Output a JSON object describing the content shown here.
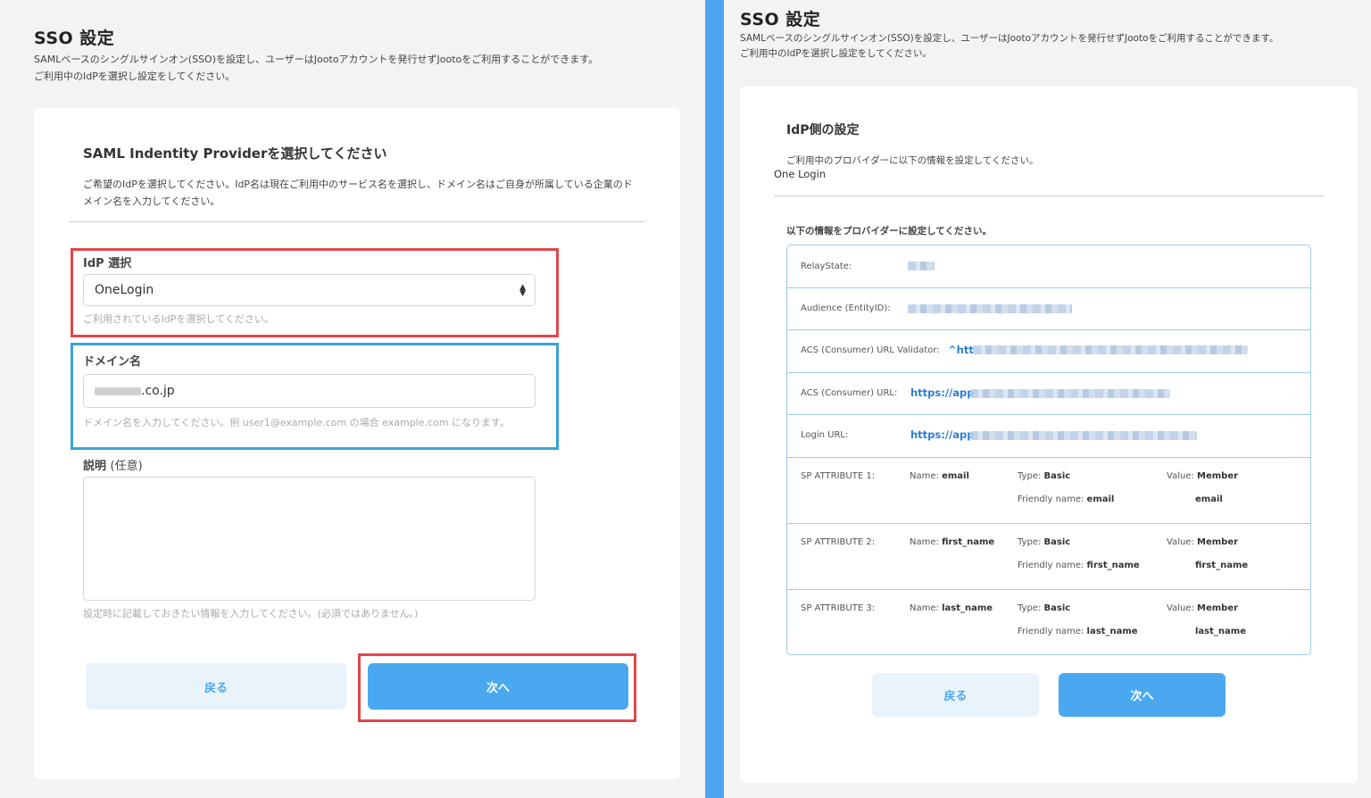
{
  "left": {
    "title": "SSO 設定",
    "desc_line1": "SAMLベースのシングルサインオン(SSO)を設定し、ユーザーはJootoアカウントを発行せずJootoをご利用することができます。",
    "desc_line2": "ご利用中のIdPを選択し設定をしてください。",
    "section_title": "SAML Indentity Providerを選択してください",
    "section_desc": "ご希望のIdPを選択してください。IdP名は現在ご利用中のサービス名を選択し、ドメイン名はご自身が所属している企業のドメイン名を入力してください。",
    "idp": {
      "label": "IdP 選択",
      "value": "OneLogin",
      "help": "ご利用されているIdPを選択してください。"
    },
    "domain": {
      "label": "ドメイン名",
      "value_suffix": ".co.jp",
      "help": "ドメイン名を入力してください。例 user1@example.com の場合 example.com になります。"
    },
    "description": {
      "label": "説明",
      "label_optional": "(任意)",
      "value": "",
      "help": "設定時に記載しておきたい情報を入力してください。(必須ではありません。)"
    },
    "back_label": "戻る",
    "next_label": "次へ"
  },
  "right": {
    "title": "SSO 設定",
    "desc_line1": "SAMLベースのシングルサインオン(SSO)を設定し、ユーザーはJootoアカウントを発行せずJootoをご利用することができます。",
    "desc_line2": "ご利用中のIdPを選択し設定をしてください。",
    "section_title": "IdP側の設定",
    "section_desc": "ご利用中のプロバイダーに以下の情報を設定してください。",
    "provider": "One Login",
    "instruction": "以下の情報をプロバイダーに設定してください。",
    "rows": [
      {
        "label": "RelayState:",
        "value": ""
      },
      {
        "label": "Audience (EntityID):",
        "value": ""
      },
      {
        "label": "ACS (Consumer) URL Validator:",
        "value": "^htt"
      },
      {
        "label": "ACS (Consumer) URL:",
        "value": "https://app"
      },
      {
        "label": "Login URL:",
        "value": "https://app"
      }
    ],
    "attributes": [
      {
        "label": "SP ATTRIBUTE 1:",
        "name_key": "Name:",
        "name": "email",
        "type_key": "Type:",
        "type": "Basic",
        "value_key": "Value:",
        "value": "Member",
        "friendly_key": "Friendly name:",
        "friendly": "email",
        "value2": "email"
      },
      {
        "label": "SP ATTRIBUTE 2:",
        "name_key": "Name:",
        "name": "first_name",
        "type_key": "Type:",
        "type": "Basic",
        "value_key": "Value:",
        "value": "Member",
        "friendly_key": "Friendly name:",
        "friendly": "first_name",
        "value2": "first_name"
      },
      {
        "label": "SP ATTRIBUTE 3:",
        "name_key": "Name:",
        "name": "last_name",
        "type_key": "Type:",
        "type": "Basic",
        "value_key": "Value:",
        "value": "Member",
        "friendly_key": "Friendly name:",
        "friendly": "last_name",
        "value2": "last_name"
      }
    ],
    "back_label": "戻る",
    "next_label": "次へ"
  },
  "colors": {
    "accent_blue": "#4aa8f0",
    "highlight_red": "#e0474c",
    "highlight_blue": "#3ba2d8",
    "divider_blue": "#4ea5ef"
  }
}
